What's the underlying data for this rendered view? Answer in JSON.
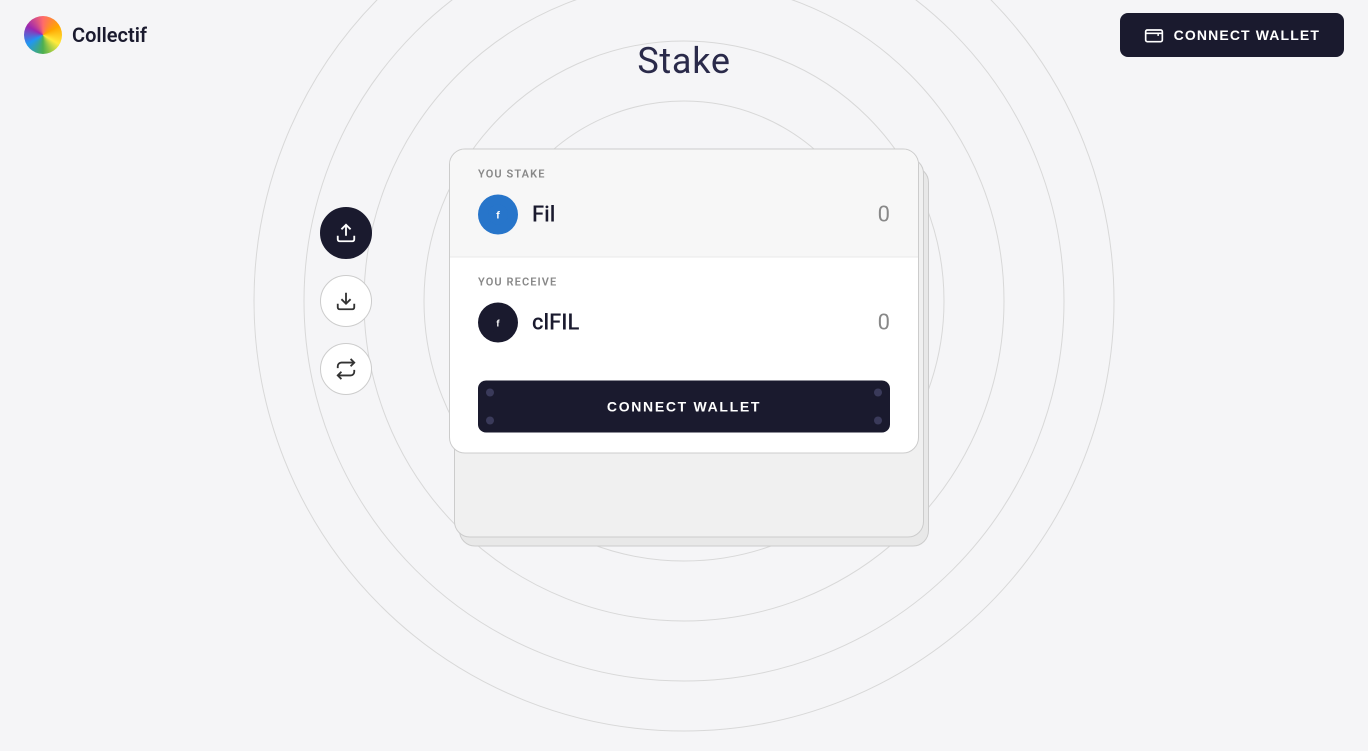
{
  "header": {
    "logo_text": "Collectif",
    "connect_wallet_label": "CONNECT WALLET"
  },
  "page": {
    "title": "Stake"
  },
  "side_nav": {
    "buttons": [
      {
        "id": "stake-icon",
        "active": true,
        "icon": "stake"
      },
      {
        "id": "withdraw-icon",
        "active": false,
        "icon": "withdraw"
      },
      {
        "id": "swap-icon",
        "active": false,
        "icon": "swap"
      }
    ]
  },
  "stake_card": {
    "you_stake_label": "YOU STAKE",
    "you_receive_label": "YOU RECEIVE",
    "stake_token": {
      "name": "Fil",
      "amount": "0"
    },
    "receive_token": {
      "name": "clFIL",
      "amount": "0"
    },
    "connect_wallet_label": "CONNECT WALLET"
  },
  "colors": {
    "dark": "#1a1a2e",
    "accent": "#2775CA",
    "bg": "#f5f5f7",
    "border": "#cccccc"
  }
}
